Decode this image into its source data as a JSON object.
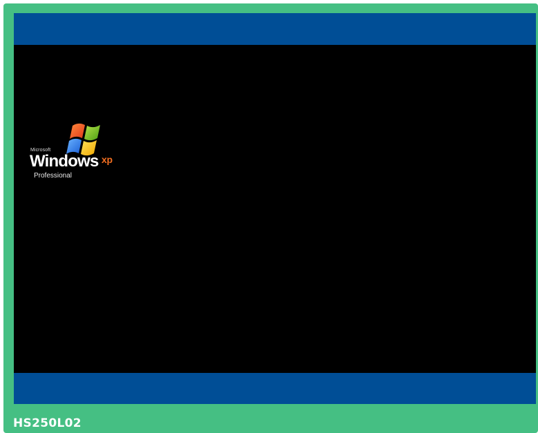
{
  "boot_screen": {
    "logo": {
      "brand": "Microsoft",
      "product": "Windows",
      "version": "xp",
      "edition": "Professional",
      "icon": "windows-flag-icon"
    }
  },
  "caption": {
    "label": "HS250L02"
  },
  "colors": {
    "frame": "#45bf83",
    "screen": "#000000",
    "bars": "#004e96",
    "xp_accent": "#f36f21",
    "flag_red": "#f25022",
    "flag_green": "#7fba00",
    "flag_blue": "#00a4ef",
    "flag_yellow": "#ffb900"
  }
}
